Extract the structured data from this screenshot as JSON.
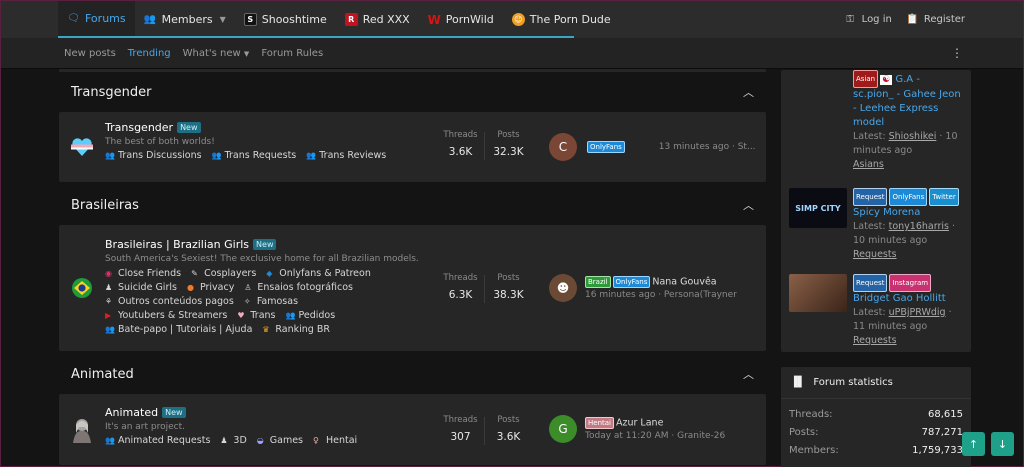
{
  "nav": {
    "forums": "Forums",
    "members": "Members",
    "links": [
      {
        "label": "Shooshtime",
        "color": "#111111",
        "glyph": "S"
      },
      {
        "label": "Red XXX",
        "color": "#c1121f",
        "glyph": "R"
      },
      {
        "label": "PornWild",
        "color": "#b31b1b",
        "glyph": "W"
      },
      {
        "label": "The Porn Dude",
        "color": "#f0a020",
        "glyph": "☺"
      }
    ],
    "login": "Log in",
    "register": "Register"
  },
  "subnav": {
    "new_posts": "New posts",
    "trending": "Trending",
    "whats_new": "What's new",
    "rules": "Forum Rules"
  },
  "categories": {
    "transgender": {
      "title": "Transgender",
      "node": {
        "title": "Transgender",
        "badge": "New",
        "desc": "The best of both worlds!",
        "subs": [
          "Trans Discussions",
          "Trans Requests",
          "Trans Reviews"
        ],
        "threads_label": "Threads",
        "threads": "3.6K",
        "posts_label": "Posts",
        "posts": "32.3K",
        "avatar_letter": "C",
        "tag": "OnlyFans",
        "last_time": "13 minutes ago · St..."
      }
    },
    "brasileiras": {
      "title": "Brasileiras",
      "node": {
        "title": "Brasileiras | Brazilian Girls",
        "badge": "New",
        "desc": "South America's Sexiest! The exclusive home for all Brazilian models.",
        "subs": [
          "Close Friends",
          "Cosplayers",
          "Onlyfans & Patreon",
          "Suicide Girls",
          "Privacy",
          "Ensaios fotográficos",
          "Outros conteúdos pagos",
          "Famosas",
          "Youtubers & Streamers",
          "Trans",
          "Pedidos",
          "Bate-papo | Tutoriais | Ajuda",
          "Ranking BR"
        ],
        "threads_label": "Threads",
        "threads": "6.3K",
        "posts_label": "Posts",
        "posts": "38.3K",
        "tag1": "Brazil",
        "tag2": "OnlyFans",
        "last_title": "Nana Gouvêa",
        "last_time": "16 minutes ago · Persona(Trayner"
      }
    },
    "animated": {
      "title": "Animated",
      "node": {
        "title": "Animated",
        "badge": "New",
        "desc": "It's an art project.",
        "subs": [
          "Animated Requests",
          "3D",
          "Games",
          "Hentai"
        ],
        "threads_label": "Threads",
        "threads": "307",
        "posts_label": "Posts",
        "posts": "3.6K",
        "avatar_letter": "G",
        "tag": "Hentai",
        "last_title": "Azur Lane",
        "last_time": "Today at 11:20 AM · Granite-26"
      }
    }
  },
  "sidebar": {
    "post1": {
      "tag": "Asian",
      "title": "G.A - sc.pion_ - Gahee Jeon - Leehee Express model",
      "latest": "Latest:",
      "user": "Shioshikei",
      "time": "· 10 minutes ago",
      "forum": "Asians"
    },
    "post2": {
      "tag1": "Request",
      "tag2": "OnlyFans",
      "tag3": "Twitter",
      "title": "Spicy Morena",
      "latest": "Latest:",
      "user": "tony16harris",
      "time": "· 10 minutes ago",
      "forum": "Requests",
      "thumb_text": "SIMP CITY"
    },
    "post3": {
      "tag1": "Request",
      "tag2": "Instagram",
      "title": "Bridget Gao Hollitt",
      "latest": "Latest:",
      "user": "uPBjPRWdig",
      "time": "· 11 minutes ago",
      "forum": "Requests"
    },
    "stats": {
      "title": "Forum statistics",
      "threads_label": "Threads:",
      "threads": "68,615",
      "posts_label": "Posts:",
      "posts": "787,271",
      "members_label": "Members:",
      "members": "1,759,733"
    }
  }
}
